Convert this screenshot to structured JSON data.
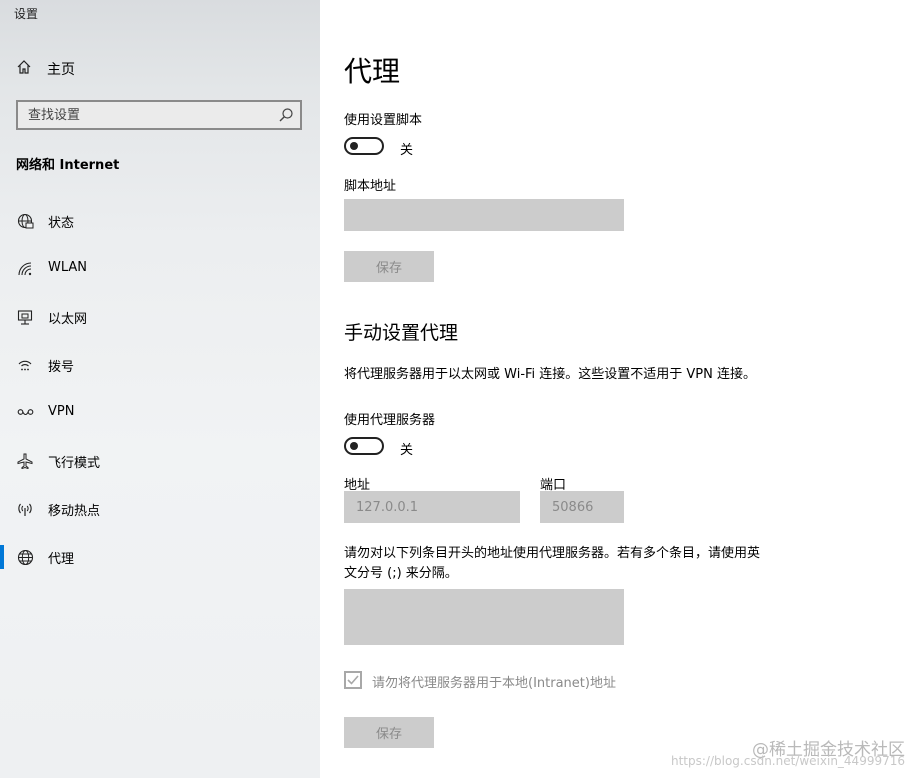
{
  "app": {
    "title": "设置"
  },
  "sidebar": {
    "home_label": "主页",
    "search_placeholder": "查找设置",
    "section_title": "网络和 Internet",
    "items": [
      {
        "label": "状态",
        "icon": "globe-status-icon"
      },
      {
        "label": "WLAN",
        "icon": "wifi-icon"
      },
      {
        "label": "以太网",
        "icon": "ethernet-icon"
      },
      {
        "label": "拨号",
        "icon": "dialup-icon"
      },
      {
        "label": "VPN",
        "icon": "vpn-icon"
      },
      {
        "label": "飞行模式",
        "icon": "airplane-icon"
      },
      {
        "label": "移动热点",
        "icon": "hotspot-icon"
      },
      {
        "label": "代理",
        "icon": "globe-icon",
        "active": true
      }
    ]
  },
  "main": {
    "title": "代理",
    "auto": {
      "use_script_label": "使用设置脚本",
      "use_script_state": "关",
      "script_address_label": "脚本地址",
      "script_address_value": "",
      "save_label": "保存"
    },
    "manual": {
      "title": "手动设置代理",
      "description": "将代理服务器用于以太网或 Wi-Fi 连接。这些设置不适用于 VPN 连接。",
      "use_proxy_label": "使用代理服务器",
      "use_proxy_state": "关",
      "address_label": "地址",
      "address_value": "127.0.0.1",
      "port_label": "端口",
      "port_value": "50866",
      "exceptions_line1": "请勿对以下列条目开头的地址使用代理服务器。若有多个条目，请使用英",
      "exceptions_line2": "文分号 (;) 来分隔。",
      "exceptions_value": "",
      "bypass_local_label": "请勿将代理服务器用于本地(Intranet)地址",
      "bypass_local_checked": true,
      "save_label": "保存"
    }
  },
  "watermark": {
    "text": "@稀土掘金技术社区",
    "url": "https://blog.csdn.net/weixin_44999716"
  },
  "colors": {
    "accent": "#0078d7",
    "disabled_field": "#cccccc",
    "disabled_text": "#8a8a8a"
  }
}
